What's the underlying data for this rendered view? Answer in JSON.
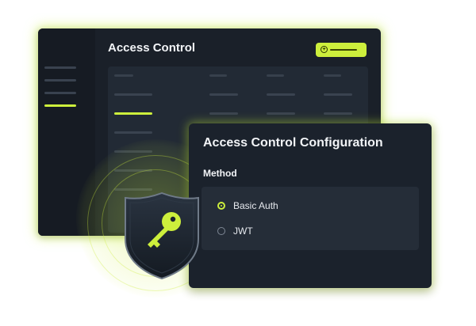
{
  "back_window": {
    "title": "Access Control"
  },
  "dialog": {
    "title": "Access Control Configuration",
    "method_label": "Method",
    "options": [
      {
        "label": "Basic Auth",
        "selected": true
      },
      {
        "label": "JWT",
        "selected": false
      }
    ]
  },
  "icons": {
    "shield": "shield-key-icon",
    "add": "plus-circle-icon"
  },
  "colors": {
    "accent": "#cdef3c",
    "window_bg": "#1a2029",
    "panel_bg": "#222a35"
  }
}
